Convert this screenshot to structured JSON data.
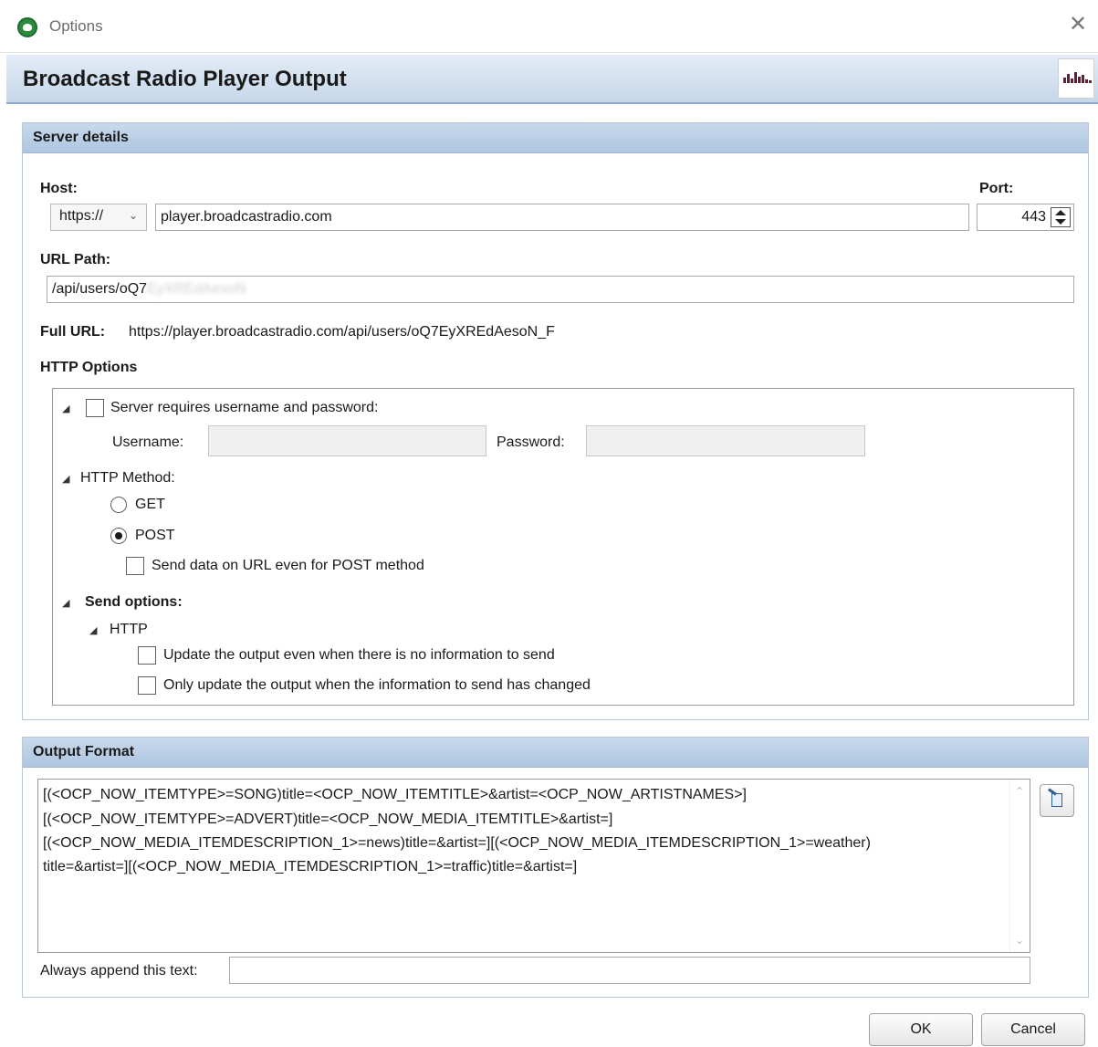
{
  "window": {
    "title": "Options",
    "close_glyph": "✕"
  },
  "header": {
    "title": "Broadcast Radio Player Output",
    "logo_icon": "equalizer-logo-icon"
  },
  "server_details": {
    "heading": "Server details",
    "host_label": "Host:",
    "protocol_value": "https://",
    "host_value": "player.broadcastradio.com",
    "port_label": "Port:",
    "port_value": "443",
    "url_path_label": "URL Path:",
    "url_path_value": "/api/users/oQ7",
    "url_path_blurred": "EyXREdAesoN",
    "full_url_label": "Full URL:",
    "full_url_value": "https://player.broadcastradio.com/api/users/oQ7EyXREdAesoN_F",
    "http_options_label": "HTTP Options"
  },
  "http_options": {
    "auth_label": "Server requires username and password:",
    "auth_checked": false,
    "username_label": "Username:",
    "username_value": "",
    "password_label": "Password:",
    "password_value": "",
    "method_label": "HTTP Method:",
    "get_label": "GET",
    "post_label": "POST",
    "selected_method": "POST",
    "send_on_url_label": "Send data on URL even for POST method",
    "send_on_url_checked": false,
    "send_options_label": "Send options:",
    "http_node_label": "HTTP",
    "update_no_info_label": "Update the output even when there is no information to send",
    "update_no_info_checked": false,
    "only_changed_label": "Only update the output when the information to send has changed",
    "only_changed_checked": false
  },
  "output_format": {
    "heading": "Output Format",
    "lines": [
      "[(<OCP_NOW_ITEMTYPE>=SONG)title=<OCP_NOW_ITEMTITLE>&artist=<OCP_NOW_ARTISTNAMES>]",
      "[(<OCP_NOW_ITEMTYPE>=ADVERT)title=<OCP_NOW_MEDIA_ITEMTITLE>&artist=]",
      "[(<OCP_NOW_MEDIA_ITEMDESCRIPTION_1>=news)title=&artist=][(<OCP_NOW_MEDIA_ITEMDESCRIPTION_1>=weather)",
      "title=&artist=][(<OCP_NOW_MEDIA_ITEMDESCRIPTION_1>=traffic)title=&artist=]"
    ],
    "append_label": "Always append this text:",
    "append_value": ""
  },
  "footer": {
    "ok_label": "OK",
    "cancel_label": "Cancel"
  },
  "colors": {
    "header_band": "#c6d7ea",
    "group_head": "#aec6e0",
    "brand_icon": "#2b8a3e"
  }
}
